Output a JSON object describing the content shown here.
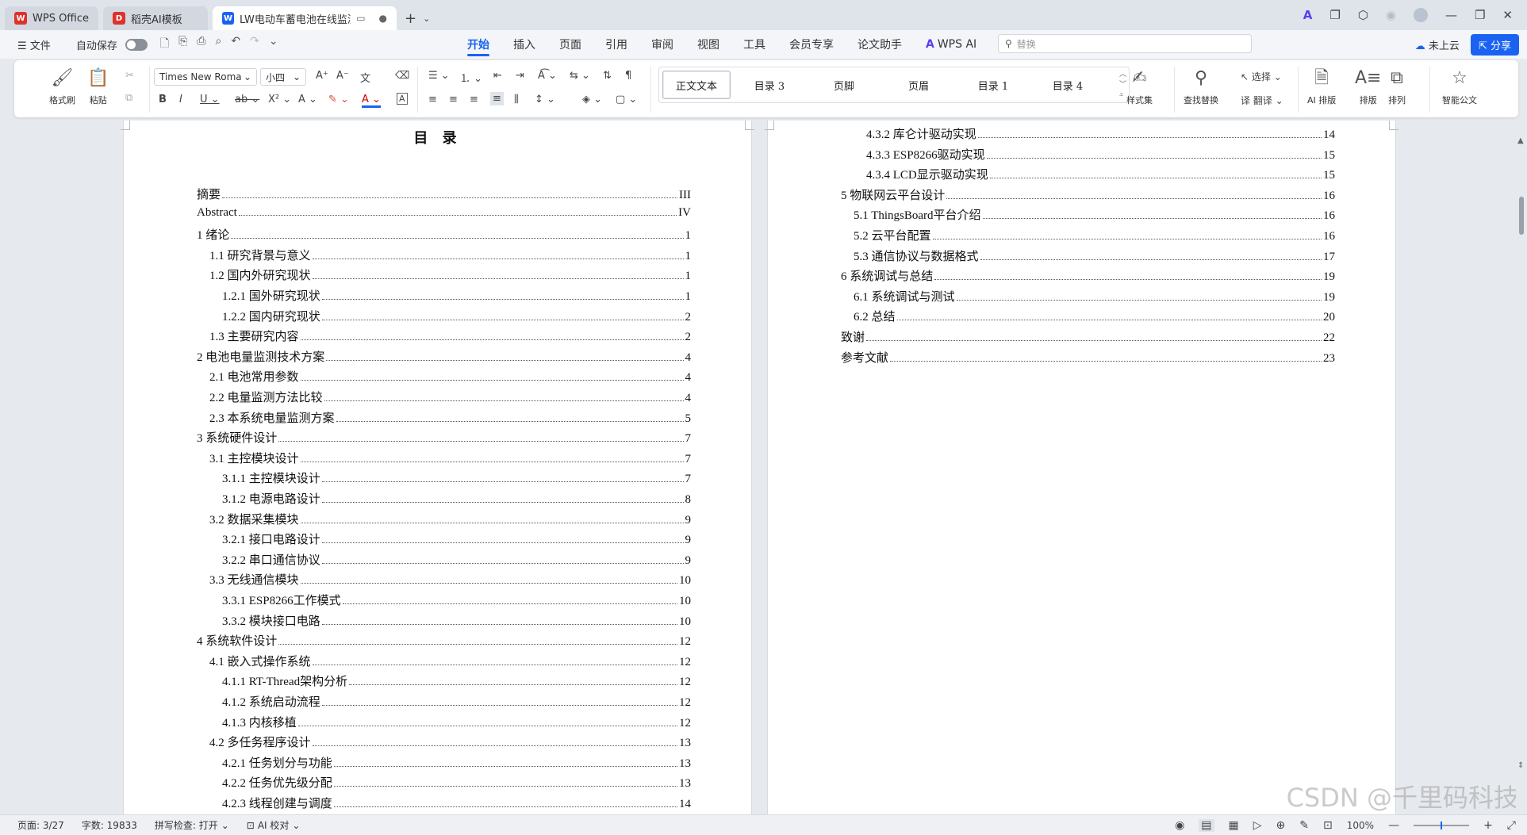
{
  "tabs": [
    {
      "label": "WPS Office",
      "icon": "wps-logo-icon",
      "color": "#e0312a",
      "active": false
    },
    {
      "label": "稻壳AI模板",
      "icon": "docer-logo-icon",
      "color": "#e0312a",
      "active": false
    },
    {
      "label": "LW电动车蓄电池在线监测系",
      "icon": "word-doc-icon",
      "color": "#1a63f2",
      "active": true
    }
  ],
  "menu": {
    "file_label": "文件",
    "autosave_label": "自动保存",
    "tabs": [
      "开始",
      "插入",
      "页面",
      "引用",
      "审阅",
      "视图",
      "工具",
      "会员专享",
      "论文助手",
      "WPS AI"
    ],
    "active_tab": "开始",
    "search_placeholder": "替换",
    "cloud_label": "未上云",
    "share_label": "分享"
  },
  "ribbon": {
    "format_painter": "格式刷",
    "paste": "粘贴",
    "font_name": "Times New Roma",
    "font_size": "小四",
    "styles": [
      "正文文本",
      "目录 3",
      "页脚",
      "页眉",
      "目录 1",
      "目录 4"
    ],
    "selected_style": "正文文本",
    "style_set": "样式集",
    "find_replace": "查找替换",
    "select": "选择",
    "translate": "翻译",
    "ai_layout": "AI 排版",
    "layout": "排版",
    "arrange": "排列",
    "smart_doc": "智能公文"
  },
  "document": {
    "toc_title": "目 录",
    "left_page": [
      {
        "t": "摘要",
        "p": "III",
        "lvl": 0
      },
      {
        "t": "Abstract",
        "p": "IV",
        "lvl": 0
      },
      {
        "t": "1 绪论",
        "p": "1",
        "lvl": 0
      },
      {
        "t": "1.1 研究背景与意义",
        "p": "1",
        "lvl": 1
      },
      {
        "t": "1.2 国内外研究现状",
        "p": "1",
        "lvl": 1
      },
      {
        "t": "1.2.1 国外研究现状",
        "p": "1",
        "lvl": 2
      },
      {
        "t": "1.2.2 国内研究现状",
        "p": "2",
        "lvl": 2
      },
      {
        "t": "1.3 主要研究内容",
        "p": "2",
        "lvl": 1
      },
      {
        "t": "2 电池电量监测技术方案",
        "p": "4",
        "lvl": 0
      },
      {
        "t": "2.1 电池常用参数",
        "p": "4",
        "lvl": 1
      },
      {
        "t": "2.2 电量监测方法比较",
        "p": "4",
        "lvl": 1
      },
      {
        "t": "2.3 本系统电量监测方案",
        "p": "5",
        "lvl": 1
      },
      {
        "t": "3 系统硬件设计",
        "p": "7",
        "lvl": 0
      },
      {
        "t": "3.1 主控模块设计",
        "p": "7",
        "lvl": 1
      },
      {
        "t": "3.1.1 主控模块设计",
        "p": "7",
        "lvl": 2
      },
      {
        "t": "3.1.2 电源电路设计",
        "p": "8",
        "lvl": 2
      },
      {
        "t": "3.2 数据采集模块",
        "p": "9",
        "lvl": 1
      },
      {
        "t": "3.2.1 接口电路设计",
        "p": "9",
        "lvl": 2
      },
      {
        "t": "3.2.2 串口通信协议",
        "p": "9",
        "lvl": 2
      },
      {
        "t": "3.3 无线通信模块",
        "p": "10",
        "lvl": 1
      },
      {
        "t": "3.3.1 ESP8266工作模式",
        "p": "10",
        "lvl": 2
      },
      {
        "t": "3.3.2 模块接口电路",
        "p": "10",
        "lvl": 2
      },
      {
        "t": "4 系统软件设计",
        "p": "12",
        "lvl": 0
      },
      {
        "t": "4.1 嵌入式操作系统",
        "p": "12",
        "lvl": 1
      },
      {
        "t": "4.1.1 RT-Thread架构分析",
        "p": "12",
        "lvl": 2
      },
      {
        "t": "4.1.2 系统启动流程",
        "p": "12",
        "lvl": 2
      },
      {
        "t": "4.1.3 内核移植",
        "p": "12",
        "lvl": 2
      },
      {
        "t": "4.2 多任务程序设计",
        "p": "13",
        "lvl": 1
      },
      {
        "t": "4.2.1 任务划分与功能",
        "p": "13",
        "lvl": 2
      },
      {
        "t": "4.2.2 任务优先级分配",
        "p": "13",
        "lvl": 2
      },
      {
        "t": "4.2.3 线程创建与调度",
        "p": "14",
        "lvl": 2
      }
    ],
    "right_page": [
      {
        "t": "4.3.2 库仑计驱动实现",
        "p": "14",
        "lvl": 2
      },
      {
        "t": "4.3.3 ESP8266驱动实现",
        "p": "15",
        "lvl": 2
      },
      {
        "t": "4.3.4 LCD显示驱动实现",
        "p": "15",
        "lvl": 2
      },
      {
        "t": "5 物联网云平台设计",
        "p": "16",
        "lvl": 0
      },
      {
        "t": "5.1 ThingsBoard平台介绍",
        "p": "16",
        "lvl": 1
      },
      {
        "t": "5.2 云平台配置",
        "p": "16",
        "lvl": 1
      },
      {
        "t": "5.3 通信协议与数据格式",
        "p": "17",
        "lvl": 1
      },
      {
        "t": "6 系统调试与总结",
        "p": "19",
        "lvl": 0
      },
      {
        "t": "6.1 系统调试与测试",
        "p": "19",
        "lvl": 1
      },
      {
        "t": "6.2 总结",
        "p": "20",
        "lvl": 1
      },
      {
        "t": "致谢",
        "p": "22",
        "lvl": 0
      },
      {
        "t": "参考文献",
        "p": "23",
        "lvl": 0
      }
    ]
  },
  "status": {
    "page": "页面: 3/27",
    "words": "字数: 19833",
    "spellcheck": "拼写检查: 打开",
    "ai_proof": "AI 校对",
    "zoom": "100%"
  },
  "watermark": "CSDN @千里码科技"
}
